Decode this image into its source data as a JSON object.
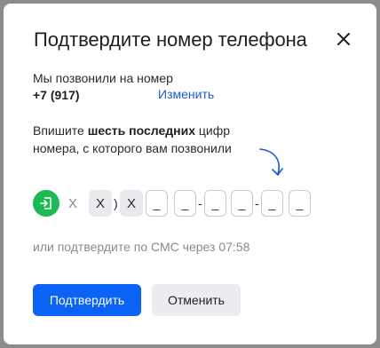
{
  "dialog": {
    "title": "Подтвердите номер телефона",
    "close_icon": "close-icon"
  },
  "call_info": {
    "text": "Мы позвонили на номер",
    "phone": "+7 (917)",
    "change_link": "Изменить"
  },
  "hint": {
    "prefix": "Впишите ",
    "bold": "шесть последних",
    "suffix": " цифр номера, с которого вам позвонили"
  },
  "code": {
    "icon": "incoming-call-icon",
    "icon_color": "#1db954",
    "masked_digits": [
      "X",
      "X",
      "X"
    ],
    "close_paren": ")",
    "slots": [
      "_",
      "_",
      "_",
      "_",
      "_",
      "_"
    ],
    "dash": "-"
  },
  "sms_text": "или подтвердите по СМС через 07:58",
  "buttons": {
    "confirm": "Подтвердить",
    "cancel": "Отменить"
  },
  "colors": {
    "primary": "#0b63f6",
    "link": "#1a5bd6"
  }
}
